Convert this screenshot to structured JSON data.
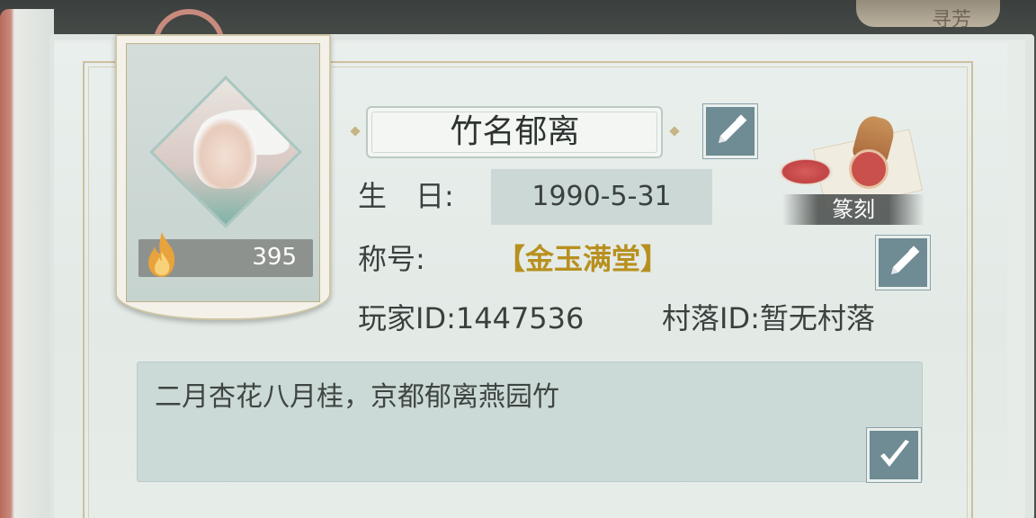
{
  "header": {
    "deco_text": "寻芳"
  },
  "profile": {
    "fire_count": "395",
    "name": "竹名郁离",
    "birthday_label": "生　日:",
    "birthday_value": "1990-5-31",
    "title_label": "称号:",
    "title_value": "【金玉满堂】",
    "player_id_text": "玩家ID:1447536",
    "village_id_text": "村落ID:暂无村落",
    "motto": "二月杏花八月桂，京都郁离燕园竹"
  },
  "seal": {
    "label": "篆刻"
  },
  "icons": {
    "edit_name": "pencil-icon",
    "edit_title": "pencil-icon",
    "confirm_motto": "checkmark-icon",
    "fire": "flame-icon"
  },
  "colors": {
    "title_gold": "#b8901f",
    "button_bg": "#6f8b94",
    "page_bg": "#e6ece8"
  }
}
